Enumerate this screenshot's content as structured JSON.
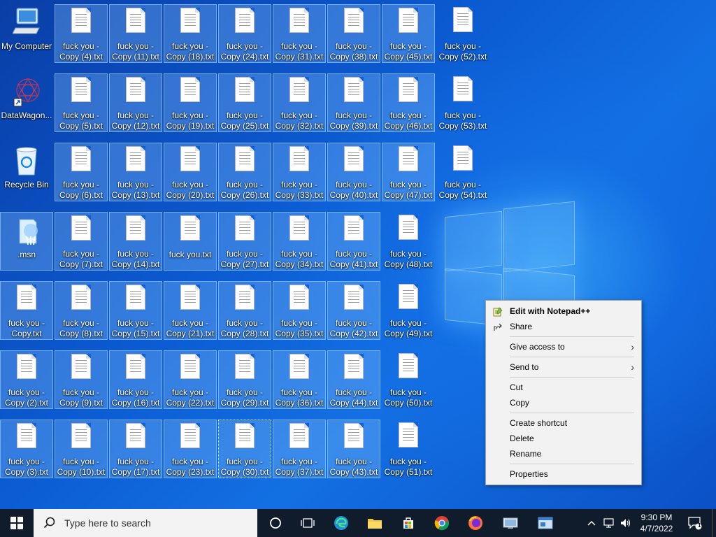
{
  "desktop": {
    "system_icons": [
      {
        "label": "My Computer",
        "icon": "computer-icon"
      },
      {
        "label": "DataWagon...",
        "icon": "datawagon-shortcut-icon"
      },
      {
        "label": "Recycle Bin",
        "icon": "recycle-bin-icon"
      },
      {
        "label": ".msn",
        "icon": "msn-icon"
      }
    ],
    "files": [
      [
        "fuck you - Copy (4).txt",
        "fuck you - Copy (11).txt",
        "fuck you - Copy (18).txt",
        "fuck you - Copy (24).txt",
        "fuck you - Copy (31).txt",
        "fuck you - Copy (38).txt",
        "fuck you - Copy (45).txt",
        "fuck you - Copy (52).txt"
      ],
      [
        "fuck you - Copy (5).txt",
        "fuck you - Copy (12).txt",
        "fuck you - Copy (19).txt",
        "fuck you - Copy (25).txt",
        "fuck you - Copy (32).txt",
        "fuck you - Copy (39).txt",
        "fuck you - Copy (46).txt",
        "fuck you - Copy (53).txt"
      ],
      [
        "fuck you - Copy (6).txt",
        "fuck you - Copy (13).txt",
        "fuck you - Copy (20).txt",
        "fuck you - Copy (26).txt",
        "fuck you - Copy (33).txt",
        "fuck you - Copy (40).txt",
        "fuck you - Copy (47).txt",
        "fuck you - Copy (54).txt"
      ],
      [
        "fuck you - Copy (7).txt",
        "fuck you - Copy (14).txt",
        "fuck you.txt",
        "fuck you - Copy (27).txt",
        "fuck you - Copy (34).txt",
        "fuck you - Copy (41).txt",
        "fuck you - Copy (48).txt"
      ],
      [
        "fuck you - Copy.txt",
        "fuck you - Copy (8).txt",
        "fuck you - Copy (15).txt",
        "fuck you - Copy (21).txt",
        "fuck you - Copy (28).txt",
        "fuck you - Copy (35).txt",
        "fuck you - Copy (42).txt",
        "fuck you - Copy (49).txt"
      ],
      [
        "fuck you - Copy (2).txt",
        "fuck you - Copy (9).txt",
        "fuck you - Copy (16).txt",
        "fuck you - Copy (22).txt",
        "fuck you - Copy (29).txt",
        "fuck you - Copy (36).txt",
        "fuck you - Copy (44).txt",
        "fuck you - Copy (50).txt"
      ],
      [
        "fuck you - Copy (3).txt",
        "fuck you - Copy (10).txt",
        "fuck you - Copy (17).txt",
        "fuck you - Copy (23).txt",
        "fuck you - Copy (30).txt",
        "fuck you - Copy (37).txt",
        "fuck you - Copy (43).txt",
        "fuck you - Copy (51).txt"
      ]
    ]
  },
  "context_menu": {
    "items": [
      {
        "label": "Edit with Notepad++",
        "bold": true,
        "icon": "notepadpp-icon"
      },
      {
        "label": "Share",
        "icon": "share-icon"
      },
      {
        "separator": true
      },
      {
        "label": "Give access to",
        "submenu": true
      },
      {
        "separator": true
      },
      {
        "label": "Send to",
        "submenu": true
      },
      {
        "separator": true
      },
      {
        "label": "Cut"
      },
      {
        "label": "Copy"
      },
      {
        "separator": true
      },
      {
        "label": "Create shortcut"
      },
      {
        "label": "Delete"
      },
      {
        "label": "Rename"
      },
      {
        "separator": true
      },
      {
        "label": "Properties"
      }
    ]
  },
  "taskbar": {
    "search_placeholder": "Type here to search",
    "pinned": [
      "cortana-icon",
      "task-view-icon",
      "edge-icon",
      "file-explorer-icon",
      "microsoft-store-icon",
      "chrome-icon",
      "firefox-icon",
      "remote-desktop-icon",
      "app-window-icon"
    ],
    "clock": {
      "time": "9:30 PM",
      "date": "4/7/2022"
    },
    "notification_count": "1"
  }
}
